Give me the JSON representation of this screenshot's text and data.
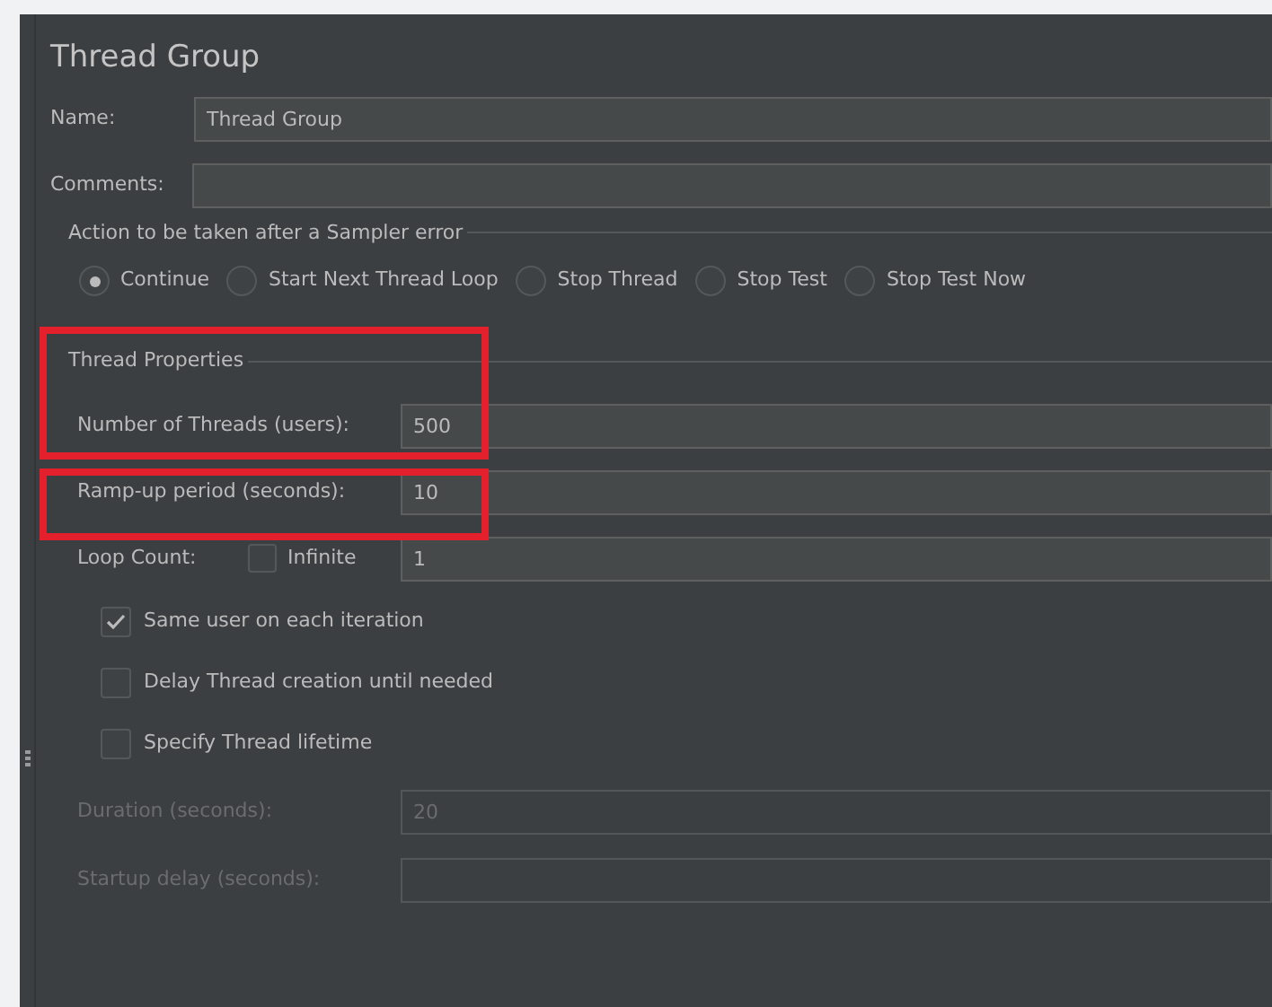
{
  "title": "Thread Group",
  "name_field": {
    "label": "Name:",
    "value": "Thread Group"
  },
  "comments_field": {
    "label": "Comments:"
  },
  "sampler_error": {
    "legend": "Action to be taken after a Sampler error",
    "options": [
      {
        "label": "Continue",
        "selected": true
      },
      {
        "label": "Start Next Thread Loop",
        "selected": false
      },
      {
        "label": "Stop Thread",
        "selected": false
      },
      {
        "label": "Stop Test",
        "selected": false
      },
      {
        "label": "Stop Test Now",
        "selected": false
      }
    ]
  },
  "thread_properties": {
    "legend": "Thread Properties",
    "fields": [
      {
        "label": "Number of Threads (users):",
        "value": "500",
        "highlighted": true
      },
      {
        "label": "Ramp-up period (seconds):",
        "value": "10",
        "highlighted": true
      }
    ],
    "loop": {
      "label": "Loop Count:",
      "infinite_label": "Infinite",
      "infinite_checked": false,
      "value": "1"
    },
    "checkboxes": [
      {
        "label": "Same user on each iteration",
        "checked": true
      },
      {
        "label": "Delay Thread creation until needed",
        "checked": false
      },
      {
        "label": "Specify Thread lifetime",
        "checked": false
      }
    ],
    "lifetime_fields": [
      {
        "label": "Duration (seconds):",
        "value": "20",
        "disabled": true
      },
      {
        "label": "Startup delay (seconds):",
        "disabled": true
      }
    ]
  }
}
